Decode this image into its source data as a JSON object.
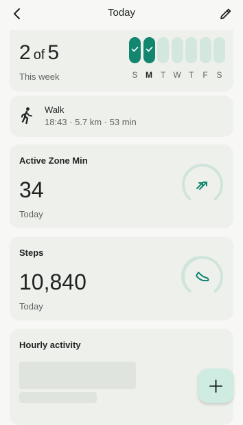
{
  "header": {
    "title": "Today",
    "back_icon": "chevron-left-icon",
    "edit_icon": "pencil-icon"
  },
  "weekly_goal": {
    "done": "2",
    "of": "of",
    "target": "5",
    "subtitle": "This week",
    "days": [
      {
        "label": "S",
        "done": true,
        "today": false
      },
      {
        "label": "M",
        "done": true,
        "today": true
      },
      {
        "label": "T",
        "done": false,
        "today": false
      },
      {
        "label": "W",
        "done": false,
        "today": false
      },
      {
        "label": "T",
        "done": false,
        "today": false
      },
      {
        "label": "F",
        "done": false,
        "today": false
      },
      {
        "label": "S",
        "done": false,
        "today": false
      }
    ]
  },
  "walk": {
    "icon": "walking-person-icon",
    "title": "Walk",
    "meta": "18:43 · 5.7 km · 53 min"
  },
  "active_zone": {
    "title": "Active Zone Min",
    "value": "34",
    "sub": "Today",
    "icon": "heart-arrows-icon"
  },
  "steps": {
    "title": "Steps",
    "value": "10,840",
    "sub": "Today",
    "icon": "shoe-icon"
  },
  "hourly": {
    "title": "Hourly activity"
  },
  "fab": {
    "icon": "plus-icon"
  },
  "colors": {
    "accent": "#13866f",
    "accent_light": "#d3e7df",
    "card": "#eef0ec",
    "background": "#f7f8f5"
  }
}
